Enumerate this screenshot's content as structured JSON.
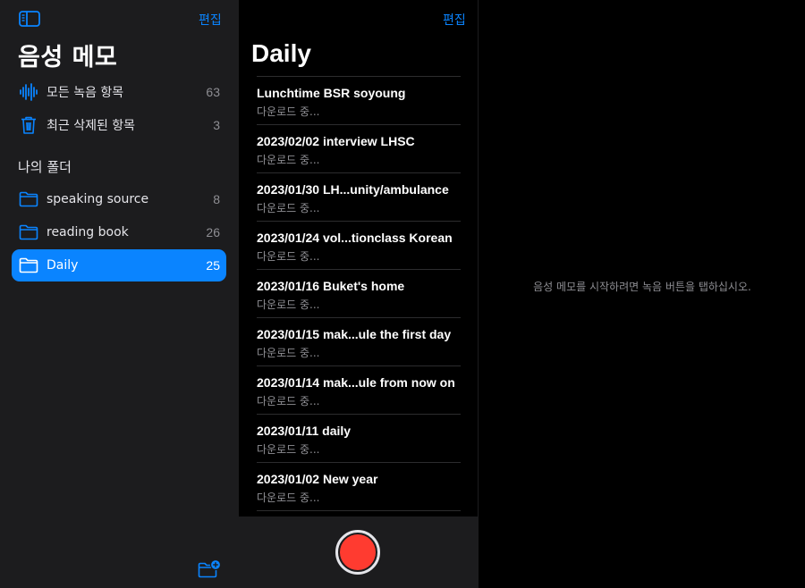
{
  "sidebar": {
    "edit_label": "편집",
    "title": "음성 메모",
    "library": [
      {
        "label": "모든 녹음 항목",
        "count": "63",
        "icon": "waveform-icon"
      },
      {
        "label": "최근 삭제된 항목",
        "count": "3",
        "icon": "trash-icon"
      }
    ],
    "folders_header": "나의 폴더",
    "folders": [
      {
        "label": "speaking source",
        "count": "8",
        "icon": "folder-icon"
      },
      {
        "label": "reading book",
        "count": "26",
        "icon": "folder-icon"
      },
      {
        "label": "Daily",
        "count": "25",
        "icon": "folder-icon",
        "selected": true
      }
    ]
  },
  "list": {
    "edit_label": "편집",
    "title": "Daily",
    "recordings": [
      {
        "title": "Lunchtime BSR soyoung",
        "status": "다운로드 중..."
      },
      {
        "title": "2023/02/02 interview LHSC",
        "status": "다운로드 중..."
      },
      {
        "title": "2023/01/30 LH...unity/ambulance",
        "status": "다운로드 중..."
      },
      {
        "title": "2023/01/24 vol...tionclass Korean",
        "status": "다운로드 중..."
      },
      {
        "title": "2023/01/16 Buket's home",
        "status": "다운로드 중..."
      },
      {
        "title": "2023/01/15 mak...ule the first day",
        "status": "다운로드 중..."
      },
      {
        "title": "2023/01/14 mak...ule from now on",
        "status": "다운로드 중..."
      },
      {
        "title": "2023/01/11 daily",
        "status": "다운로드 중..."
      },
      {
        "title": "2023/01/02 New year",
        "status": "다운로드 중..."
      }
    ]
  },
  "detail": {
    "empty_hint": "음성 메모를 시작하려면 녹음 버튼을 탭하십시오."
  },
  "colors": {
    "accent": "#0a84ff",
    "record": "#ff3b30",
    "sidebar_bg": "#1c1c1e"
  }
}
